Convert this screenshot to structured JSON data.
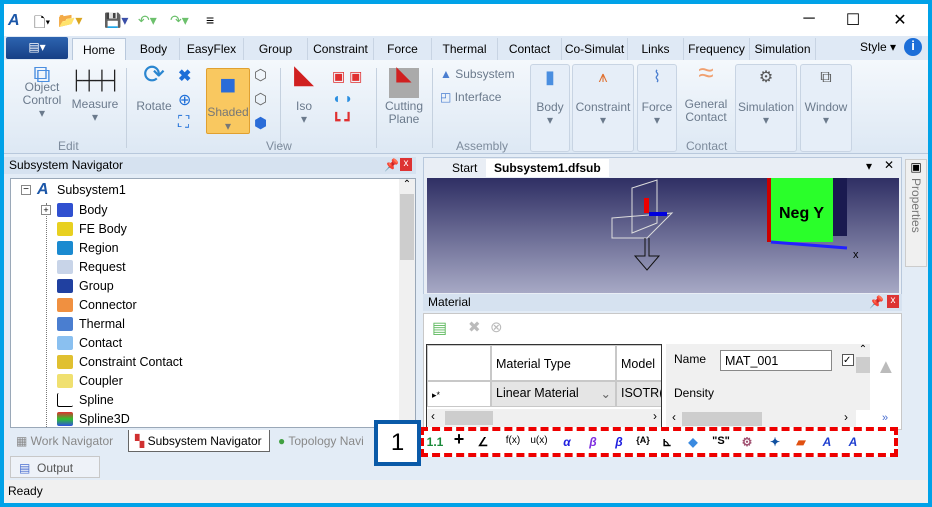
{
  "colors": {
    "frame": "#00a2e8",
    "accent": "#1c57a8",
    "highlight": "#f9c860",
    "dashed_border": "#e00000",
    "badge_border": "#0a5aa8"
  },
  "quick_access": {
    "icons": [
      "app-logo-icon",
      "new-file-icon",
      "open-folder-icon",
      "save-icon",
      "undo-icon",
      "redo-icon",
      "customize-icon"
    ]
  },
  "window_controls": {
    "minimize": "─",
    "maximize": "☐",
    "close": "✕"
  },
  "ribbon": {
    "file_button": "▤▾",
    "tabs": [
      "Home",
      "Body",
      "EasyFlex",
      "Group",
      "Constraint",
      "Force",
      "Thermal",
      "Contact",
      "Co-Simulat",
      "Links",
      "Frequency",
      "Simulation"
    ],
    "active_tab": "Home",
    "style_label": "Style",
    "info_icon": "i",
    "edit": {
      "label": "Edit",
      "object_control": "Object Control",
      "measure": "Measure"
    },
    "view": {
      "label": "View",
      "rotate": "Rotate",
      "shaded": "Shaded",
      "iso": "Iso",
      "cutting_plane": "Cutting Plane"
    },
    "assembly": {
      "label": "Assembly",
      "subsystem": "Subsystem",
      "interface": "Interface"
    },
    "body": "Body",
    "constraint": "Constraint",
    "force": "Force",
    "contact": {
      "label": "Contact",
      "general_contact": "General Contact"
    },
    "simulation": "Simulation",
    "window": "Window"
  },
  "navigator": {
    "title": "Subsystem Navigator",
    "root": "Subsystem1",
    "items": [
      "Body",
      "FE Body",
      "Region",
      "Request",
      "Group",
      "Connector",
      "Thermal",
      "Contact",
      "Constraint Contact",
      "Coupler",
      "Spline",
      "Spline3D"
    ],
    "bottom_tabs": [
      "Work Navigator",
      "Subsystem Navigator",
      "Topology Navi"
    ],
    "output_tab": "Output"
  },
  "document": {
    "tabs": [
      "Start",
      "Subsystem1.dfsub"
    ],
    "active_tab": "Subsystem1.dfsub",
    "view_cube_label": "Neg Y",
    "axis_label": "x"
  },
  "properties_tab": "Properties",
  "material": {
    "title": "Material",
    "columns": [
      "",
      "Material Type",
      "Model"
    ],
    "row": {
      "marker": "▸*",
      "material_type": "Linear Material",
      "model": "ISOTR("
    },
    "name_label": "Name",
    "name_value": "MAT_001",
    "density_label": "Density",
    "more": "»"
  },
  "bottom_toolbar": {
    "items": [
      "1.1",
      "+",
      "∠",
      "f(x)",
      "u(x)",
      "α",
      "β",
      "β",
      "{A}",
      "⊾",
      "◆",
      "\"S\"",
      "⚙",
      "✦",
      "▰",
      "A",
      "A"
    ]
  },
  "callout_badge": "1",
  "status": "Ready"
}
